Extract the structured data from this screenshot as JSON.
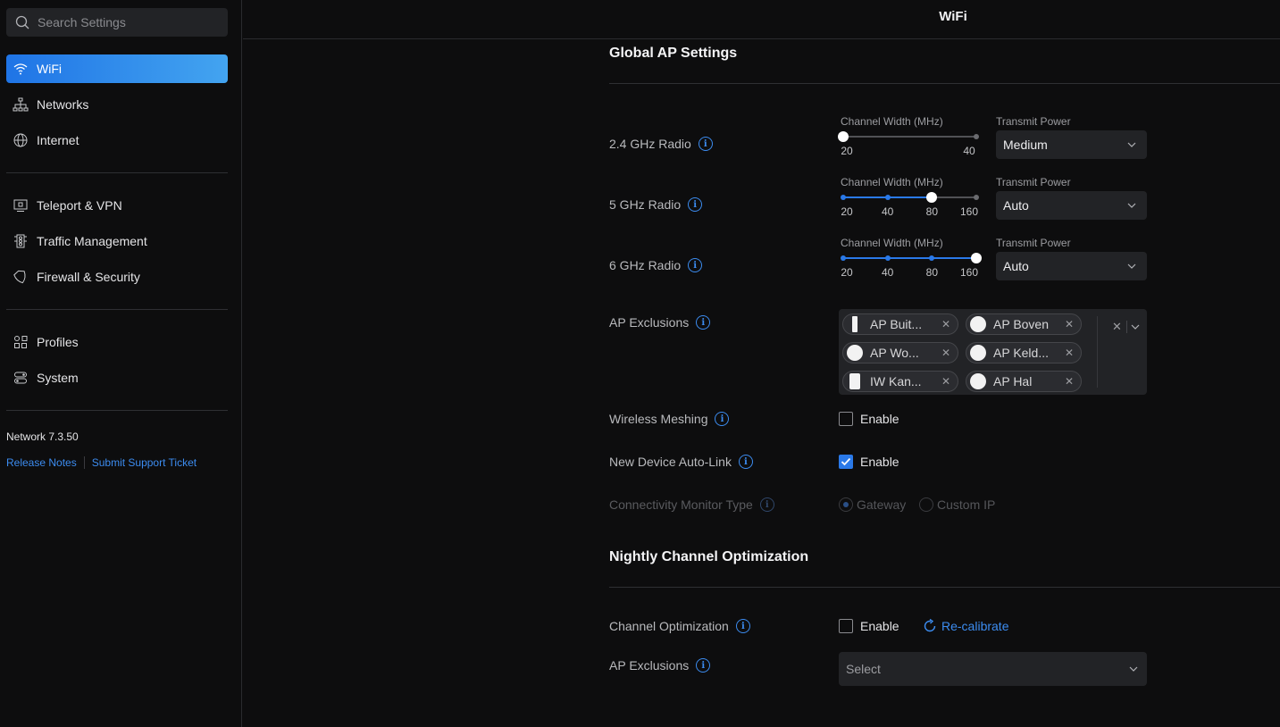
{
  "sidebar": {
    "search_placeholder": "Search Settings",
    "items": [
      {
        "label": "WiFi",
        "icon": "wifi-icon",
        "active": true
      },
      {
        "label": "Networks",
        "icon": "network-tree-icon"
      },
      {
        "label": "Internet",
        "icon": "globe-icon"
      },
      {
        "label": "Teleport & VPN",
        "icon": "teleport-icon"
      },
      {
        "label": "Traffic Management",
        "icon": "traffic-icon"
      },
      {
        "label": "Firewall & Security",
        "icon": "shield-icon"
      },
      {
        "label": "Profiles",
        "icon": "profiles-icon"
      },
      {
        "label": "System",
        "icon": "system-icon"
      }
    ],
    "version": "Network 7.3.50",
    "release_notes": "Release Notes",
    "support_ticket": "Submit Support Ticket"
  },
  "header": {
    "title": "WiFi"
  },
  "global": {
    "title": "Global AP Settings",
    "channel_width_label": "Channel Width (MHz)",
    "transmit_power_label": "Transmit Power",
    "radios": [
      {
        "label": "2.4 GHz Radio",
        "ticks": [
          "20",
          "40"
        ],
        "selected_index": 0,
        "power": "Medium"
      },
      {
        "label": "5 GHz Radio",
        "ticks": [
          "20",
          "40",
          "80",
          "160"
        ],
        "selected_index": 2,
        "power": "Auto"
      },
      {
        "label": "6 GHz Radio",
        "ticks": [
          "20",
          "40",
          "80",
          "160"
        ],
        "selected_index": 3,
        "power": "Auto"
      }
    ],
    "ap_exclusions_label": "AP Exclusions",
    "ap_exclusions": [
      "AP Buit...",
      "AP Boven",
      "AP Wo...",
      "AP Keld...",
      "IW Kan...",
      "AP Hal"
    ],
    "wireless_meshing_label": "Wireless Meshing",
    "auto_link_label": "New Device Auto-Link",
    "enable_label": "Enable",
    "wireless_meshing_enabled": false,
    "auto_link_enabled": true,
    "monitor_label": "Connectivity Monitor Type",
    "monitor_options": [
      "Gateway",
      "Custom IP"
    ],
    "monitor_selected": "Gateway"
  },
  "nightly": {
    "title": "Nightly Channel Optimization",
    "optimization_label": "Channel Optimization",
    "enable_label": "Enable",
    "recalibrate_label": "Re-calibrate",
    "ap_exclusions_label": "AP Exclusions",
    "select_placeholder": "Select"
  },
  "colors": {
    "accent": "#2a79e8",
    "link": "#3c8cf0",
    "background": "#0d0d0e",
    "panel": "#222326"
  }
}
